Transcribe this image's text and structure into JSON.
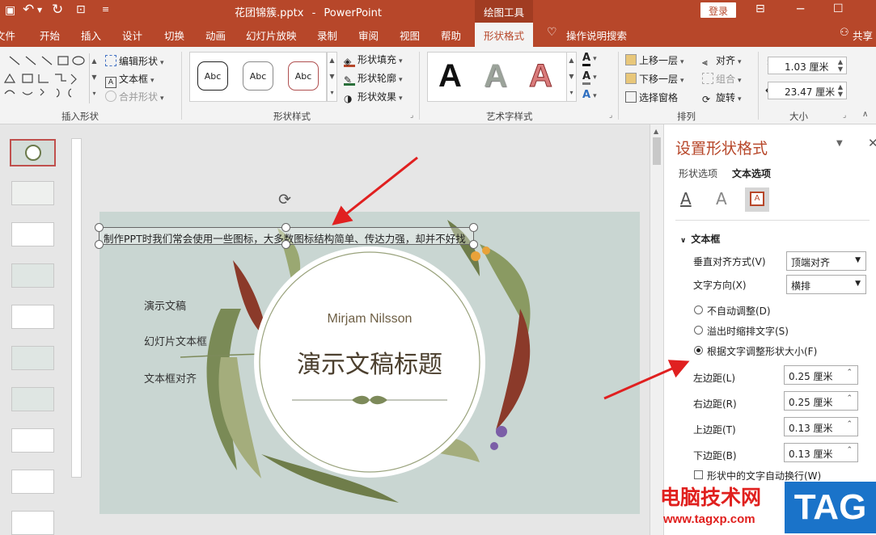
{
  "window": {
    "doc_title": "花团锦簇.pptx",
    "app_name": "PowerPoint",
    "tool_group": "绘图工具",
    "login_label": "登录",
    "title_sep": "-"
  },
  "tabs": [
    "文件",
    "开始",
    "插入",
    "设计",
    "切换",
    "动画",
    "幻灯片放映",
    "录制",
    "审阅",
    "视图",
    "帮助",
    "形状格式"
  ],
  "tell_me": "操作说明搜索",
  "share": "共享",
  "ribbon": {
    "insert_shapes": {
      "label": "插入形状",
      "edit_shape": "编辑形状",
      "text_box": "文本框",
      "merge_shapes": "合并形状"
    },
    "shape_styles": {
      "label": "形状样式",
      "sample": "Abc",
      "fill": "形状填充",
      "outline": "形状轮廓",
      "effects": "形状效果"
    },
    "wordart": {
      "label": "艺术字样式",
      "letter": "A"
    },
    "arrange": {
      "label": "排列",
      "bring_forward": "上移一层",
      "send_backward": "下移一层",
      "selection_pane": "选择窗格",
      "align": "对齐",
      "group": "组合",
      "rotate": "旋转"
    },
    "size": {
      "label": "大小",
      "height": "1.03 厘米",
      "width": "23.47 厘米"
    }
  },
  "slide": {
    "textbox_text": "制作PPT时我们常会使用一些图标，大多数图标结构简单、传达力强，却并不好找",
    "left_items": [
      "演示文稿",
      "幻灯片文本框",
      "文本框对齐"
    ],
    "author": "Mirjam Nilsson",
    "title": "演示文稿标题"
  },
  "format_pane": {
    "title": "设置形状格式",
    "tab_shape": "形状选项",
    "tab_text": "文本选项",
    "section": "文本框",
    "valign_label": "垂直对齐方式(V)",
    "valign_value": "顶端对齐",
    "direction_label": "文字方向(X)",
    "direction_value": "横排",
    "radio_no_autofit": "不自动调整(D)",
    "radio_shrink": "溢出时缩排文字(S)",
    "radio_resize": "根据文字调整形状大小(F)",
    "left_margin_label": "左边距(L)",
    "left_margin": "0.25 厘米",
    "right_margin_label": "右边距(R)",
    "right_margin": "0.25 厘米",
    "top_margin_label": "上边距(T)",
    "top_margin": "0.13 厘米",
    "bottom_margin_label": "下边距(B)",
    "bottom_margin": "0.13 厘米",
    "wrap_label": "形状中的文字自动换行(W)"
  },
  "watermark": {
    "site_name": "电脑技术网",
    "url": "www.tagxp.com",
    "logo": "TAG"
  },
  "colors": {
    "accent": "#b7472a",
    "slide_bg": "#c9d6d2",
    "arrow": "#e02020"
  }
}
